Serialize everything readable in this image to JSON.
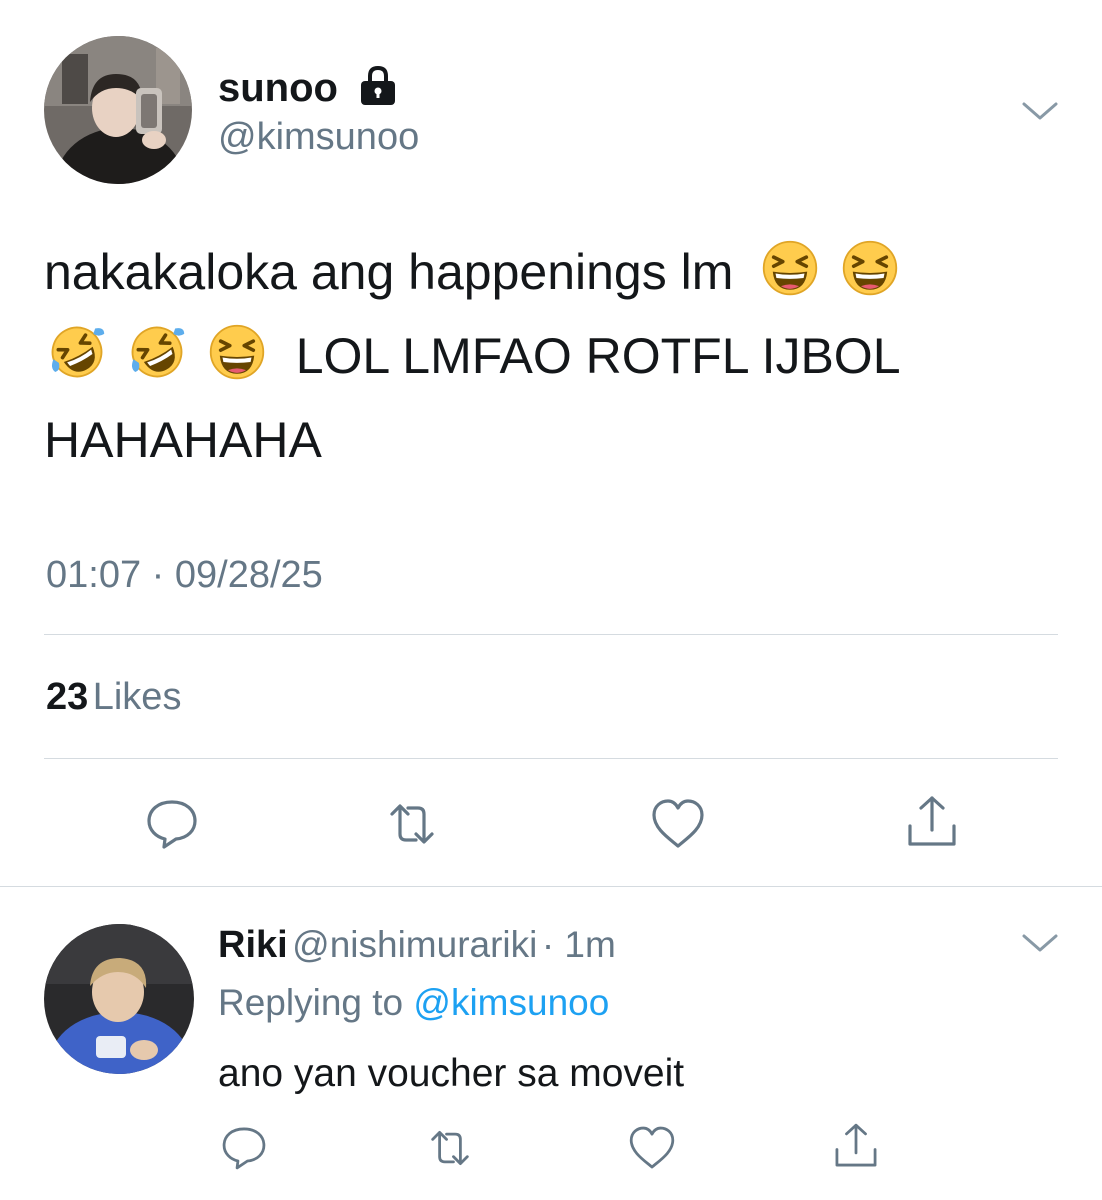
{
  "tweet": {
    "author_name": "sunoo",
    "author_handle": "@kimsunoo",
    "protected_icon": "lock-icon",
    "menu_icon": "chevron-down-icon",
    "text_line1": "nakakaloka ang happenings lm",
    "text_line2": "LOL LMFAO ROTFL IJBOL",
    "text_line3": "HAHAHAHA",
    "emojis_line1": [
      "grinning-squinting-face",
      "grinning-squinting-face"
    ],
    "emojis_line2": [
      "rolling-on-floor-laughing",
      "rolling-on-floor-laughing",
      "grinning-squinting-face"
    ],
    "time": "01:07",
    "separator": "·",
    "date": "09/28/25",
    "likes_count": "23",
    "likes_label": "Likes",
    "actions": [
      "reply-icon",
      "retweet-icon",
      "like-icon",
      "share-icon"
    ]
  },
  "reply": {
    "author_name": "Riki",
    "author_handle": "@nishimurariki",
    "time_ago": "· 1m",
    "replying_prefix": "Replying to",
    "replying_to": "@kimsunoo",
    "text": "ano yan voucher sa moveit",
    "actions": [
      "reply-icon",
      "retweet-icon",
      "like-icon",
      "share-icon"
    ]
  },
  "colors": {
    "text": "#14171a",
    "secondary": "#657786",
    "link": "#1da1f2",
    "divider": "#d5dbe0"
  }
}
